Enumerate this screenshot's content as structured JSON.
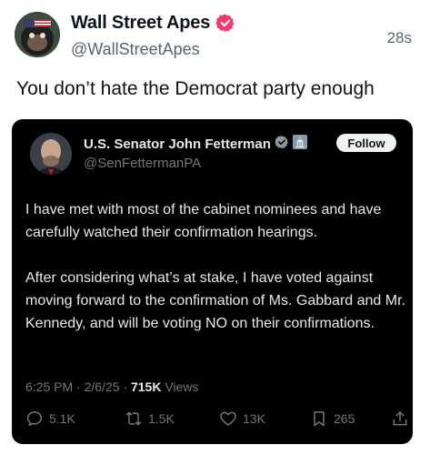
{
  "post": {
    "display_name": "Wall Street Apes",
    "handle": "@WallStreetApes",
    "time": "28s",
    "text": "You don’t hate the Democrat party enough",
    "verified_badge_color": "#f4366b"
  },
  "quoted": {
    "display_name": "U.S. Senator John Fetterman",
    "handle": "@SenFettermanPA",
    "follow_label": "Follow",
    "paragraphs": [
      "I have met with most of the cabinet nominees and have carefully watched their confirmation hearings.",
      "After considering what’s at stake, I have voted against moving forward to the confirmation of Ms. Gabbard and Mr. Kennedy, and will be voting NO on their confirmations."
    ],
    "time": "6:25 PM",
    "date": "2/6/25",
    "views_count": "715K",
    "views_label": "Views",
    "replies": "5.1K",
    "reposts": "1.5K",
    "likes": "13K",
    "bookmarks": "265",
    "badge_colors": {
      "verified": "#8b98a5",
      "government": "#829aab"
    }
  },
  "icons": [
    "verified-badge-icon",
    "government-badge-icon",
    "reply-icon",
    "repost-icon",
    "like-icon",
    "bookmark-icon",
    "share-icon"
  ]
}
